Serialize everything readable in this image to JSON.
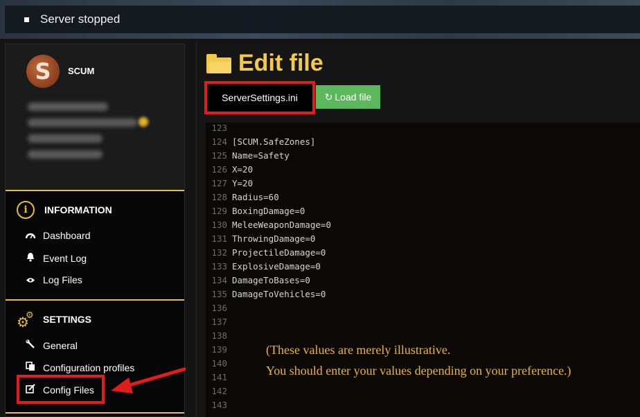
{
  "header": {
    "status": "Server stopped"
  },
  "sidebar": {
    "profile": {
      "logo_letter": "S",
      "game_name": "SCUM"
    },
    "information": {
      "title": "INFORMATION",
      "icon": "info-icon",
      "items": [
        {
          "label": "Dashboard",
          "icon": "gauge-icon"
        },
        {
          "label": "Event Log",
          "icon": "bell-icon"
        },
        {
          "label": "Log Files",
          "icon": "eye-icon"
        }
      ]
    },
    "settings": {
      "title": "SETTINGS",
      "icon": "gears-icon",
      "items": [
        {
          "label": "General",
          "icon": "wrench-icon"
        },
        {
          "label": "Configuration profiles",
          "icon": "copy-icon"
        },
        {
          "label": "Config Files",
          "icon": "edit-icon"
        }
      ]
    }
  },
  "main": {
    "title": "Edit file",
    "file_select": "ServerSettings.ini",
    "load_button": "Load file",
    "editor_lines": [
      {
        "n": "123",
        "code": ""
      },
      {
        "n": "124",
        "code": "[SCUM.SafeZones]"
      },
      {
        "n": "125",
        "code": "Name=Safety"
      },
      {
        "n": "126",
        "code": "X=20"
      },
      {
        "n": "127",
        "code": "Y=20"
      },
      {
        "n": "128",
        "code": "Radius=60"
      },
      {
        "n": "129",
        "code": "BoxingDamage=0"
      },
      {
        "n": "130",
        "code": "MeleeWeaponDamage=0"
      },
      {
        "n": "131",
        "code": "ThrowingDamage=0"
      },
      {
        "n": "132",
        "code": "ProjectileDamage=0"
      },
      {
        "n": "133",
        "code": "ExplosiveDamage=0"
      },
      {
        "n": "134",
        "code": "DamageToBases=0"
      },
      {
        "n": "135",
        "code": "DamageToVehicles=0"
      },
      {
        "n": "136",
        "code": ""
      },
      {
        "n": "137",
        "code": ""
      },
      {
        "n": "138",
        "code": ""
      },
      {
        "n": "139",
        "code": ""
      },
      {
        "n": "140",
        "code": ""
      },
      {
        "n": "141",
        "code": ""
      },
      {
        "n": "142",
        "code": ""
      },
      {
        "n": "143",
        "code": ""
      }
    ],
    "note_line1": "(These values are merely illustrative.",
    "note_line2": "You should enter your values depending on your preference.)"
  },
  "colors": {
    "accent": "#f2c94c",
    "highlight": "#e21b1b",
    "load_button": "#5cb85c"
  }
}
